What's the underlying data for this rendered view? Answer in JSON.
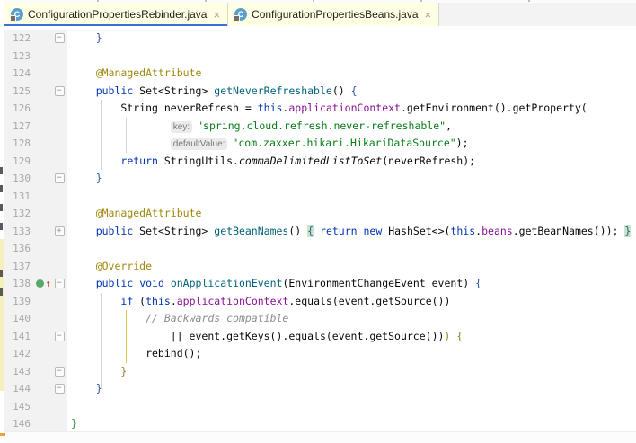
{
  "tabs": {
    "close_glyph": "×",
    "class_glyph": "C",
    "items": [
      {
        "label": "ConfigurationPropertiesRebinder.java",
        "icon": "java-class",
        "active": true
      },
      {
        "label": "ConfigurationPropertiesBeans.java",
        "icon": "java-class",
        "active": false
      }
    ]
  },
  "colors": {
    "tab_bg": "#FFFFE3",
    "tab_underline": "#3D6FD8",
    "class_icon_bg": "#59A0CF",
    "gutter_bg": "#F2F2F2",
    "line_number": "#A8A8A8",
    "keyword": "#0033B3",
    "string": "#067D17",
    "field": "#871094",
    "annotation": "#9E880D",
    "comment": "#8C8C8C",
    "method_decl": "#00627A",
    "brace_method": "#2E55A3",
    "brace_if": "#9A7F22",
    "brace_class": "#3E8E44",
    "highlight_bg": "#C9E7C8",
    "hint_bg": "#EBEBEB",
    "hint_text": "#787878"
  },
  "editor": {
    "lines": [
      {
        "n": "122",
        "g": "minus",
        "t": [
          [
            "p",
            "    "
          ],
          [
            "bm",
            "}"
          ]
        ]
      },
      {
        "n": "123",
        "t": []
      },
      {
        "n": "124",
        "t": [
          [
            "p",
            "    "
          ],
          [
            "a",
            "@ManagedAttribute"
          ]
        ]
      },
      {
        "n": "125",
        "g": "minus",
        "t": [
          [
            "p",
            "    "
          ],
          [
            "k",
            "public"
          ],
          [
            "p",
            " Set<String> "
          ],
          [
            "m",
            "getNeverRefreshable"
          ],
          [
            "p",
            "() "
          ],
          [
            "bm",
            "{"
          ]
        ]
      },
      {
        "n": "126",
        "t": [
          [
            "p",
            "        String neverRefresh = "
          ],
          [
            "k",
            "this"
          ],
          [
            "p",
            "."
          ],
          [
            "f",
            "applicationContext"
          ],
          [
            "p",
            ".getEnvironment().getProperty("
          ]
        ]
      },
      {
        "n": "127",
        "t": [
          [
            "p",
            "                "
          ],
          [
            "h",
            "key:"
          ],
          [
            "s",
            "\"spring.cloud.refresh.never-refreshable\""
          ],
          [
            "p",
            ","
          ]
        ]
      },
      {
        "n": "128",
        "t": [
          [
            "p",
            "                "
          ],
          [
            "h",
            "defaultValue:"
          ],
          [
            "s",
            "\"com.zaxxer.hikari.HikariDataSource\""
          ],
          [
            "p",
            ");"
          ]
        ]
      },
      {
        "n": "129",
        "t": [
          [
            "p",
            "        "
          ],
          [
            "k",
            "return"
          ],
          [
            "p",
            " StringUtils."
          ],
          [
            "i",
            "commaDelimitedListToSet"
          ],
          [
            "p",
            "(neverRefresh);"
          ]
        ]
      },
      {
        "n": "130",
        "g": "minus",
        "t": [
          [
            "p",
            "    "
          ],
          [
            "bm",
            "}"
          ]
        ]
      },
      {
        "n": "131",
        "t": []
      },
      {
        "n": "132",
        "t": [
          [
            "p",
            "    "
          ],
          [
            "a",
            "@ManagedAttribute"
          ]
        ]
      },
      {
        "n": "133",
        "g": "plus",
        "t": [
          [
            "p",
            "    "
          ],
          [
            "k",
            "public"
          ],
          [
            "p",
            " Set<String> "
          ],
          [
            "m",
            "getBeanNames"
          ],
          [
            "p",
            "() "
          ],
          [
            "hb",
            "{"
          ],
          [
            "p",
            " "
          ],
          [
            "k",
            "return"
          ],
          [
            "p",
            " "
          ],
          [
            "k",
            "new"
          ],
          [
            "p",
            " HashSet<>("
          ],
          [
            "k",
            "this"
          ],
          [
            "p",
            "."
          ],
          [
            "f",
            "beans"
          ],
          [
            "p",
            ".getBeanNames()); "
          ],
          [
            "hb",
            "}"
          ]
        ]
      },
      {
        "n": "136",
        "t": []
      },
      {
        "n": "137",
        "t": [
          [
            "p",
            "    "
          ],
          [
            "a",
            "@Override"
          ]
        ]
      },
      {
        "n": "138",
        "g": "minus",
        "ov": true,
        "t": [
          [
            "p",
            "    "
          ],
          [
            "k",
            "public"
          ],
          [
            "p",
            " "
          ],
          [
            "k",
            "void"
          ],
          [
            "p",
            " "
          ],
          [
            "m",
            "onApplicationEvent"
          ],
          [
            "p",
            "(EnvironmentChangeEvent event) "
          ],
          [
            "bm",
            "{"
          ]
        ]
      },
      {
        "n": "139",
        "t": [
          [
            "p",
            "        "
          ],
          [
            "k",
            "if"
          ],
          [
            "p",
            " ("
          ],
          [
            "k",
            "this"
          ],
          [
            "p",
            "."
          ],
          [
            "f",
            "applicationContext"
          ],
          [
            "p",
            ".equals(event.getSource())"
          ]
        ]
      },
      {
        "n": "140",
        "t": [
          [
            "p",
            "            "
          ],
          [
            "c",
            "// Backwards compatible"
          ]
        ]
      },
      {
        "n": "141",
        "g": "minus",
        "t": [
          [
            "p",
            "                || event.getKeys().equals(event.getSource())"
          ],
          [
            "bi",
            ") {"
          ]
        ]
      },
      {
        "n": "142",
        "t": [
          [
            "p",
            "            rebind();"
          ]
        ]
      },
      {
        "n": "143",
        "g": "minus",
        "t": [
          [
            "p",
            "        "
          ],
          [
            "bi",
            "}"
          ]
        ]
      },
      {
        "n": "144",
        "g": "minus",
        "t": [
          [
            "p",
            "    "
          ],
          [
            "bm",
            "}"
          ]
        ]
      },
      {
        "n": "145",
        "t": []
      },
      {
        "n": "146",
        "t": [
          [
            "bc",
            "}"
          ]
        ]
      }
    ]
  }
}
